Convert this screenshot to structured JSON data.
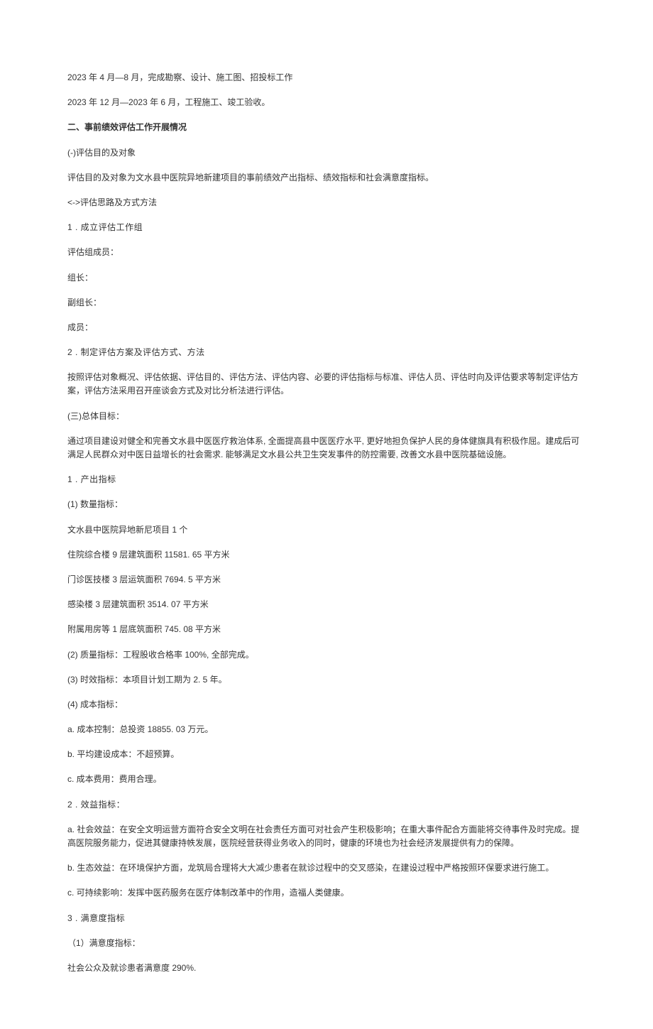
{
  "lines": {
    "l01": "2023 年 4 月—8 月，完成勘察、设计、施工图、招投标工作",
    "l02": "2023 年 12 月—2023 年 6 月，工程施工、竣工验收。",
    "l03": "二、事前绩效评估工作开展情况",
    "l04": "(-)评估目的及对象",
    "l05": "评估目的及对象为文水县中医院异地新建项目的事前绩效产出指标、绩效指标和社会满意度指标。",
    "l06": "<->评估思路及方式方法",
    "l07": "1  . 成立评估工作组",
    "l08": "评估组成员：",
    "l09": "组长：",
    "l10": "副组长：",
    "l11": "成员：",
    "l12": "2  . 制定评估方案及评估方式、方法",
    "l13": "按照评估对象概况、评估依据、评估目的、评估方法、评估内容、必要的评估指标与标准、评估人员、评估时向及评估要求等制定评估方案，评估方法采用召开座谈会方式及对比分析法进行评估。",
    "l14": "(三)总体目标：",
    "l15": "通过项目建设对健全和完善文水县中医医疗救治体系, 全面提高县中医医疗水平, 更好地担负保护人民的身体健旗具有积极作屈。建成后可满足人民群众对中医日益增长的社会需求. 能够满足文水县公共卫生突发事件的防控需要, 改善文水县中医院基础设施。",
    "l16": "1  . 产出指标",
    "l17": "(1) 数量指标：",
    "l18": "文水县中医院异地新尼项目 1 个",
    "l19": "住院综合楼 9 层建筑面积 11581. 65 平方米",
    "l20": "门诊医技楼 3 层运筑面积 7694. 5 平方米",
    "l21": "感染楼 3 层建筑面积 3514. 07 平方米",
    "l22": "附属用房等 1 层底筑面积 745. 08 平方米",
    "l23": "(2) 质量指标：工程股收合格率 100%, 全部完成。",
    "l24": "(3) 时效指标：本项目计划工期为 2. 5 年。",
    "l25": "(4) 成本指标：",
    "l26": "a. 成本控制：总投资 18855. 03 万元。",
    "l27": "b. 平均建设成本：不超预算。",
    "l28": "c. 成本费用：费用合理。",
    "l29": "2  . 效益指标：",
    "l30": "a. 社会效益：在安全文明运营方面符合安全文明在社会责任方面可对社会产生积极影响；在重大事件配合方面能将交待事件及时完成。提高医院服务能力，促进其健康持帙发展，医院经营获得业务收入的同时，健康的环境也为社会经济发展提供有力的保障。",
    "l31": "b. 生态效益：在环境保护方面，龙筑局合理将大大减少患者在就诊过程中的交叉感染，在建设过程中严格按照环保要求进行施工。",
    "l32": "c. 可持续影响：发挥中医药服务在医疗体制改革中的作用，造福人类健康。",
    "l33": "3  . 满意度指标",
    "l34": "（1）满意度指标：",
    "l35": "社会公众及就诊患者满意度 290%."
  }
}
